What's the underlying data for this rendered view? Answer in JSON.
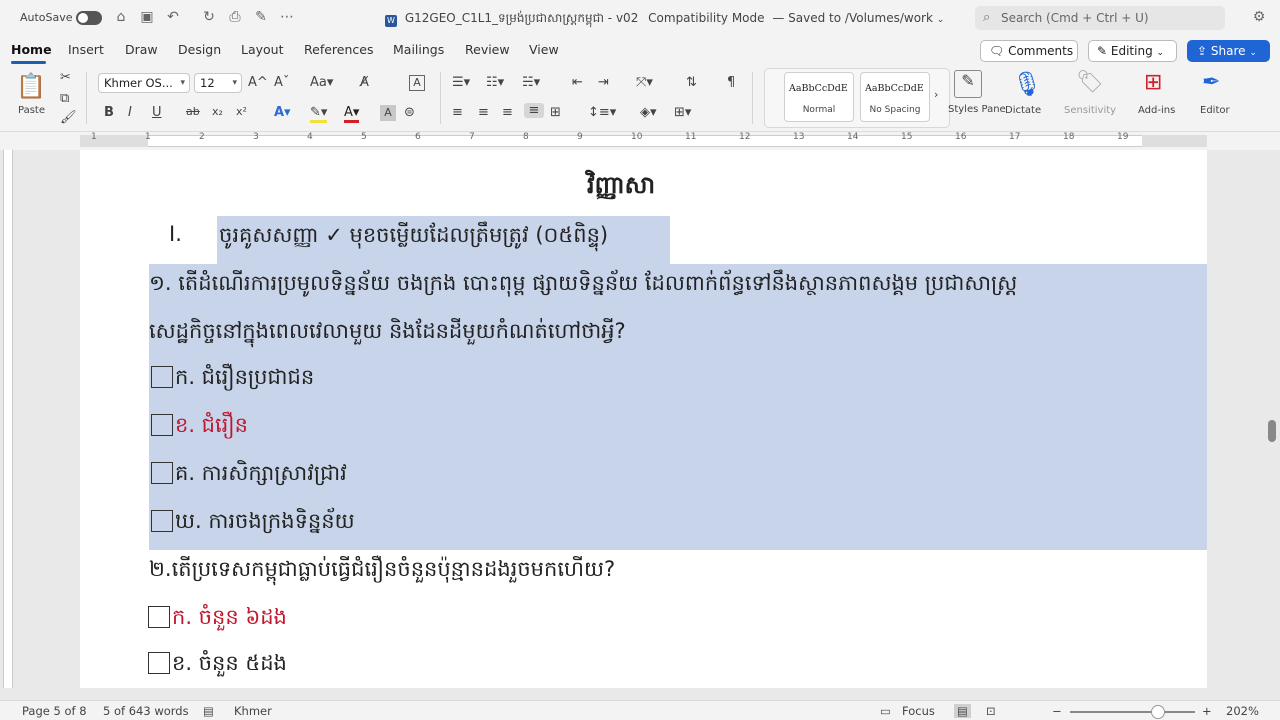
{
  "titlebar": {
    "autosave_label": "AutoSave",
    "doc_title": "G12GEO_C1L1_ទម្រង់ប្រជាសាស្ត្រកម្ពុជា - v02",
    "mode": "Compatibility Mode",
    "saved_status": "— Saved to /Volumes/work",
    "search_placeholder": "Search (Cmd + Ctrl + U)"
  },
  "ribbon": {
    "tabs": [
      "Home",
      "Insert",
      "Draw",
      "Design",
      "Layout",
      "References",
      "Mailings",
      "Review",
      "View"
    ],
    "comments_label": "Comments",
    "editing_label": "Editing",
    "share_label": "Share"
  },
  "toolbar": {
    "paste_label": "Paste",
    "font_name": "Khmer OS...",
    "font_size": "12",
    "styles": [
      {
        "preview": "AaBbCcDdE",
        "name": "Normal"
      },
      {
        "preview": "AaBbCcDdE",
        "name": "No Spacing"
      }
    ],
    "styles_pane_label": "Styles Pane",
    "dictate_label": "Dictate",
    "sensitivity_label": "Sensitivity",
    "addins_label": "Add-ins",
    "editor_label": "Editor"
  },
  "ruler": {
    "numbers": [
      "1",
      "1",
      "2",
      "3",
      "4",
      "5",
      "6",
      "7",
      "8",
      "9",
      "10",
      "11",
      "12",
      "13",
      "14",
      "15",
      "16",
      "17",
      "18",
      "19"
    ]
  },
  "document": {
    "heading": "វិញ្ញាសា",
    "section_number": "I.",
    "section_title": "ចូរគូសសញ្ញា ✓ មុខចម្លើយដែលត្រឹមត្រូវ (០៥ពិន្ទុ)",
    "q1_line1": "១. តើដំណើរការប្រមូលទិន្នន័យ ចងក្រង បោះពុម្ព ផ្សាយទិន្នន័យ ដែលពាក់ព័ន្ធទៅនឹងស្ថានភាពសង្គម ប្រជាសាស្ត្រ",
    "q1_line2": "សេដ្ឋកិច្ចនៅក្នុងពេលវេលាមួយ និងដែនដីមួយកំណត់ហៅថាអ្វី?",
    "q1_options": [
      "ក. ជំរឿនប្រជាជន",
      "ខ. ជំរឿន",
      "គ. ការសិក្សាស្រាវជ្រាវ",
      "ឃ. ការចងក្រងទិន្នន័យ"
    ],
    "q2": "២.តើប្រទេសកម្ពុជាធ្លាប់ធ្វើជំរឿនចំនួនប៉ុន្មានដងរួចមកហើយ?",
    "q2_options": [
      "ក. ចំនួន ៦ដង",
      "ខ. ចំនួន ៥ដង"
    ],
    "highlight_color": "#c0172e"
  },
  "status": {
    "page": "Page 5 of 8",
    "words": "5 of 643 words",
    "language": "Khmer",
    "focus": "Focus",
    "zoom": "202%"
  }
}
